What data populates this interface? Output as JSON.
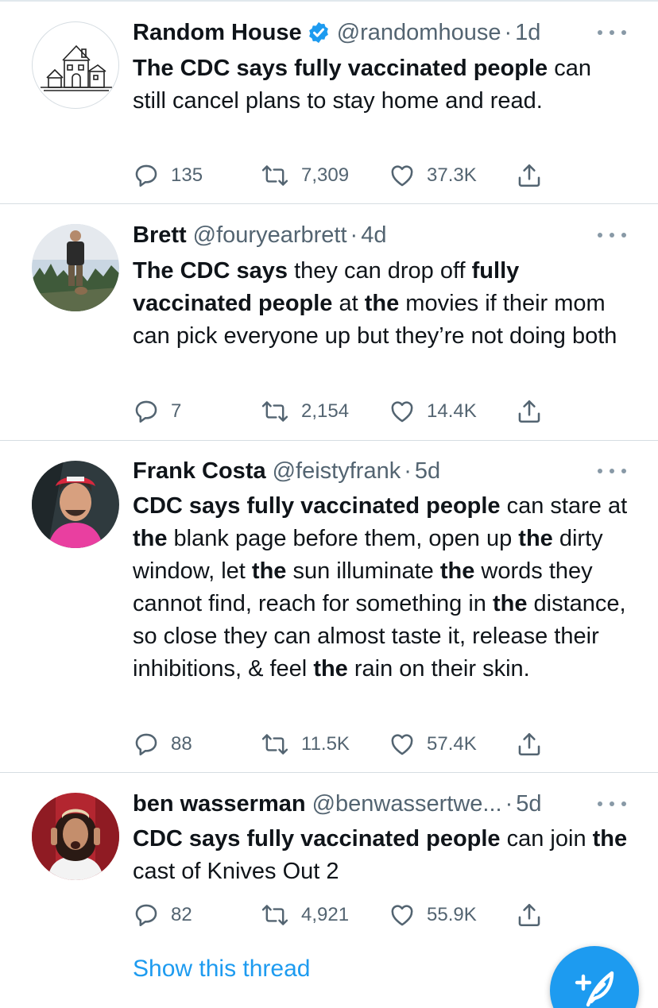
{
  "tweets": [
    {
      "name": "Random House",
      "verified": true,
      "handle": "@randomhouse",
      "separator": "·",
      "time": "1d",
      "text_html": "<b>The CDC says fully vaccinated people</b> can still cancel plans to stay home and read.",
      "replies": "135",
      "retweets": "7,309",
      "likes": "37.3K"
    },
    {
      "name": "Brett",
      "verified": false,
      "handle": "@fouryearbrett",
      "separator": "·",
      "time": "4d",
      "text_html": "<b>The CDC says</b> they can drop off <b>fully vaccinated people</b> at <b>the</b> movies if their mom can pick everyone up but they’re not doing both",
      "replies": "7",
      "retweets": "2,154",
      "likes": "14.4K"
    },
    {
      "name": "Frank Costa",
      "verified": false,
      "handle": "@feistyfrank",
      "separator": "·",
      "time": "5d",
      "text_html": "<b>CDC says fully vaccinated people</b> can stare at <b>the</b> blank page before them, open up <b>the</b> dirty window, let <b>the</b> sun illuminate <b>the</b> words they cannot find, reach for something in <b>the</b> distance, so close they can almost taste it, release their inhibitions, &amp; feel <b>the</b> rain on their skin.",
      "replies": "88",
      "retweets": "11.5K",
      "likes": "57.4K"
    },
    {
      "name": "ben wasserman",
      "verified": false,
      "handle": "@benwassertwe...",
      "separator": "·",
      "time": "5d",
      "text_html": "<b>CDC says fully vaccinated people</b> can join <b>the</b> cast of Knives Out 2",
      "replies": "82",
      "retweets": "4,921",
      "likes": "55.9K"
    }
  ],
  "show_thread_label": "Show this thread",
  "icons": {
    "reply": "reply-icon",
    "retweet": "retweet-icon",
    "like": "heart-icon",
    "share": "share-icon",
    "more": "more-icon",
    "verified": "verified-badge-icon",
    "compose": "compose-tweet-icon"
  },
  "colors": {
    "accent": "#1d9bf0",
    "text": "#0f1419",
    "secondary": "#536471",
    "divider": "#d6dde2"
  }
}
